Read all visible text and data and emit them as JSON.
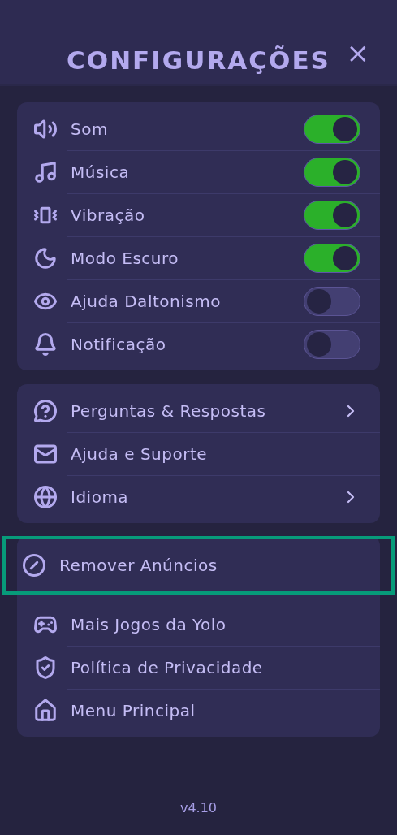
{
  "header": {
    "title": "CONFIGURAÇÕES",
    "close": "×"
  },
  "toggles": [
    {
      "label": "Som",
      "on": true
    },
    {
      "label": "Música",
      "on": true
    },
    {
      "label": "Vibração",
      "on": true
    },
    {
      "label": "Modo Escuro",
      "on": true
    },
    {
      "label": "Ajuda Daltonismo",
      "on": false
    },
    {
      "label": "Notificação",
      "on": false
    }
  ],
  "help_items": [
    {
      "label": "Perguntas & Respostas",
      "arrow": true
    },
    {
      "label": "Ajuda e Suporte",
      "arrow": false
    },
    {
      "label": "Idioma",
      "arrow": true
    }
  ],
  "more_items": [
    {
      "label": "Remover Anúncios",
      "highlighted": true
    },
    {
      "label": "Mais Jogos da Yolo",
      "highlighted": false
    },
    {
      "label": "Política de Privacidade",
      "highlighted": false
    },
    {
      "label": "Menu Principal",
      "highlighted": false
    }
  ],
  "version": "v4.10"
}
